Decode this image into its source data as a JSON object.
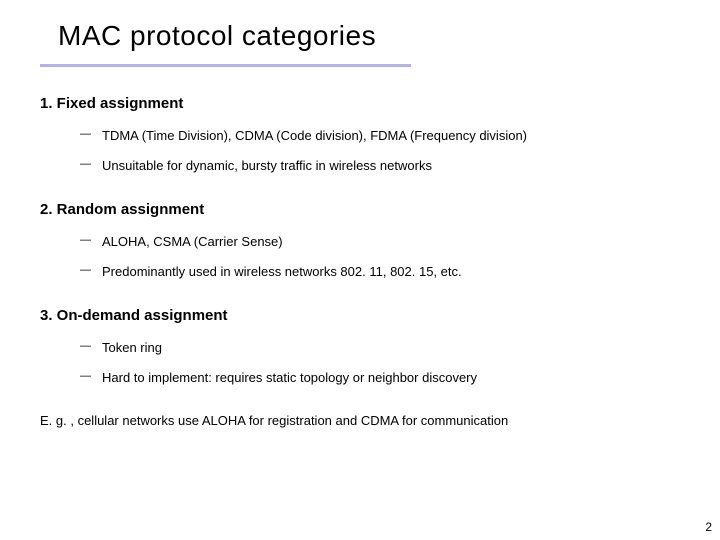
{
  "title": "MAC protocol categories",
  "sections": [
    {
      "heading": "1. Fixed assignment",
      "items": [
        "TDMA (Time Division), CDMA (Code division), FDMA (Frequency division)",
        "Unsuitable for dynamic, bursty traffic in wireless networks"
      ]
    },
    {
      "heading": "2. Random assignment",
      "items": [
        "ALOHA, CSMA (Carrier Sense)",
        "Predominantly used in wireless networks 802. 11, 802. 15, etc."
      ]
    },
    {
      "heading": "3. On-demand assignment",
      "items": [
        "Token ring",
        "Hard to implement: requires static topology or neighbor discovery"
      ]
    }
  ],
  "footnote": "E. g. , cellular networks use ALOHA for registration and CDMA for communication",
  "page_number": "2"
}
